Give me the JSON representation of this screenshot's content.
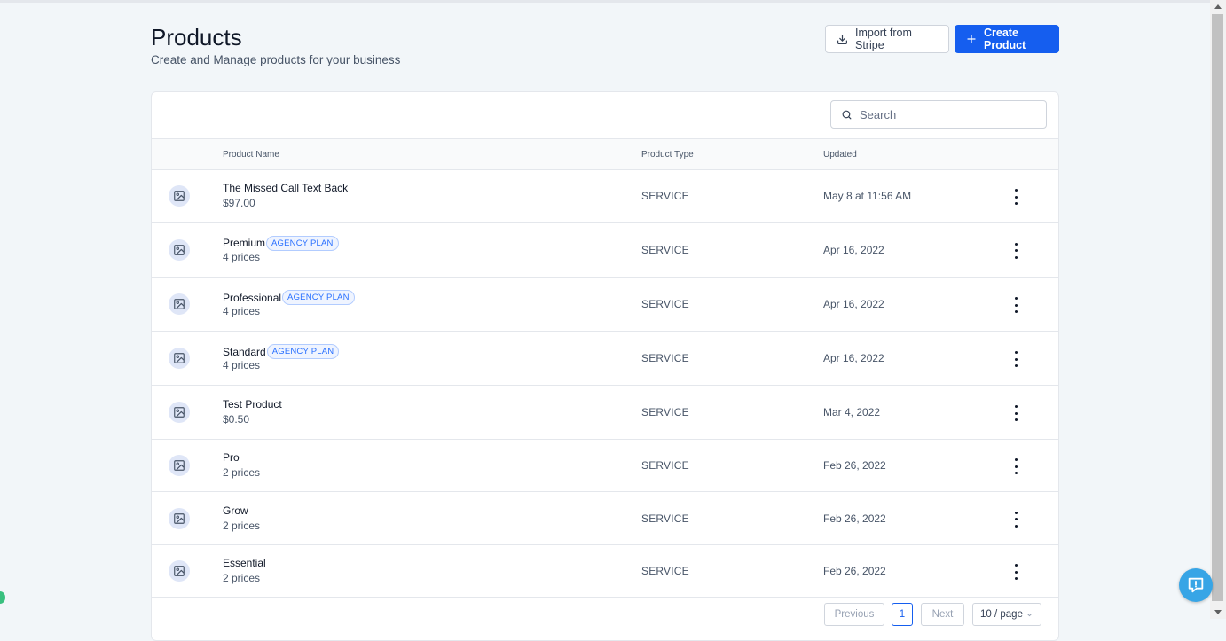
{
  "page": {
    "title": "Products",
    "subtitle": "Create and Manage products for your business"
  },
  "actions": {
    "import_label": "Import from Stripe",
    "create_label": "Create Product"
  },
  "search": {
    "placeholder": "Search"
  },
  "table": {
    "columns": {
      "name": "Product Name",
      "type": "Product Type",
      "updated": "Updated"
    },
    "rows": [
      {
        "name": "The Missed Call Text Back",
        "sub": "$97.00",
        "badge": "",
        "type": "SERVICE",
        "updated": "May 8 at 11:56 AM"
      },
      {
        "name": "Premium",
        "sub": "4 prices",
        "badge": "AGENCY PLAN",
        "type": "SERVICE",
        "updated": "Apr 16, 2022"
      },
      {
        "name": "Professional",
        "sub": "4 prices",
        "badge": "AGENCY PLAN",
        "type": "SERVICE",
        "updated": "Apr 16, 2022"
      },
      {
        "name": "Standard",
        "sub": "4 prices",
        "badge": "AGENCY PLAN",
        "type": "SERVICE",
        "updated": "Apr 16, 2022"
      },
      {
        "name": "Test Product",
        "sub": "$0.50",
        "badge": "",
        "type": "SERVICE",
        "updated": "Mar 4, 2022"
      },
      {
        "name": "Pro",
        "sub": "2 prices",
        "badge": "",
        "type": "SERVICE",
        "updated": "Feb 26, 2022"
      },
      {
        "name": "Grow",
        "sub": "2 prices",
        "badge": "",
        "type": "SERVICE",
        "updated": "Feb 26, 2022"
      },
      {
        "name": "Essential",
        "sub": "2 prices",
        "badge": "",
        "type": "SERVICE",
        "updated": "Feb 26, 2022"
      }
    ]
  },
  "pagination": {
    "previous": "Previous",
    "current": "1",
    "next": "Next",
    "page_size": "10 / page"
  },
  "colors": {
    "primary": "#155eef",
    "badge": "#2970ff",
    "fab": "#37a5e6"
  },
  "icons": {
    "import": "download-icon",
    "create": "plus-icon",
    "search": "search-icon",
    "thumb": "image-icon",
    "row_menu": "more-vertical-icon",
    "fab": "feedback-icon"
  }
}
